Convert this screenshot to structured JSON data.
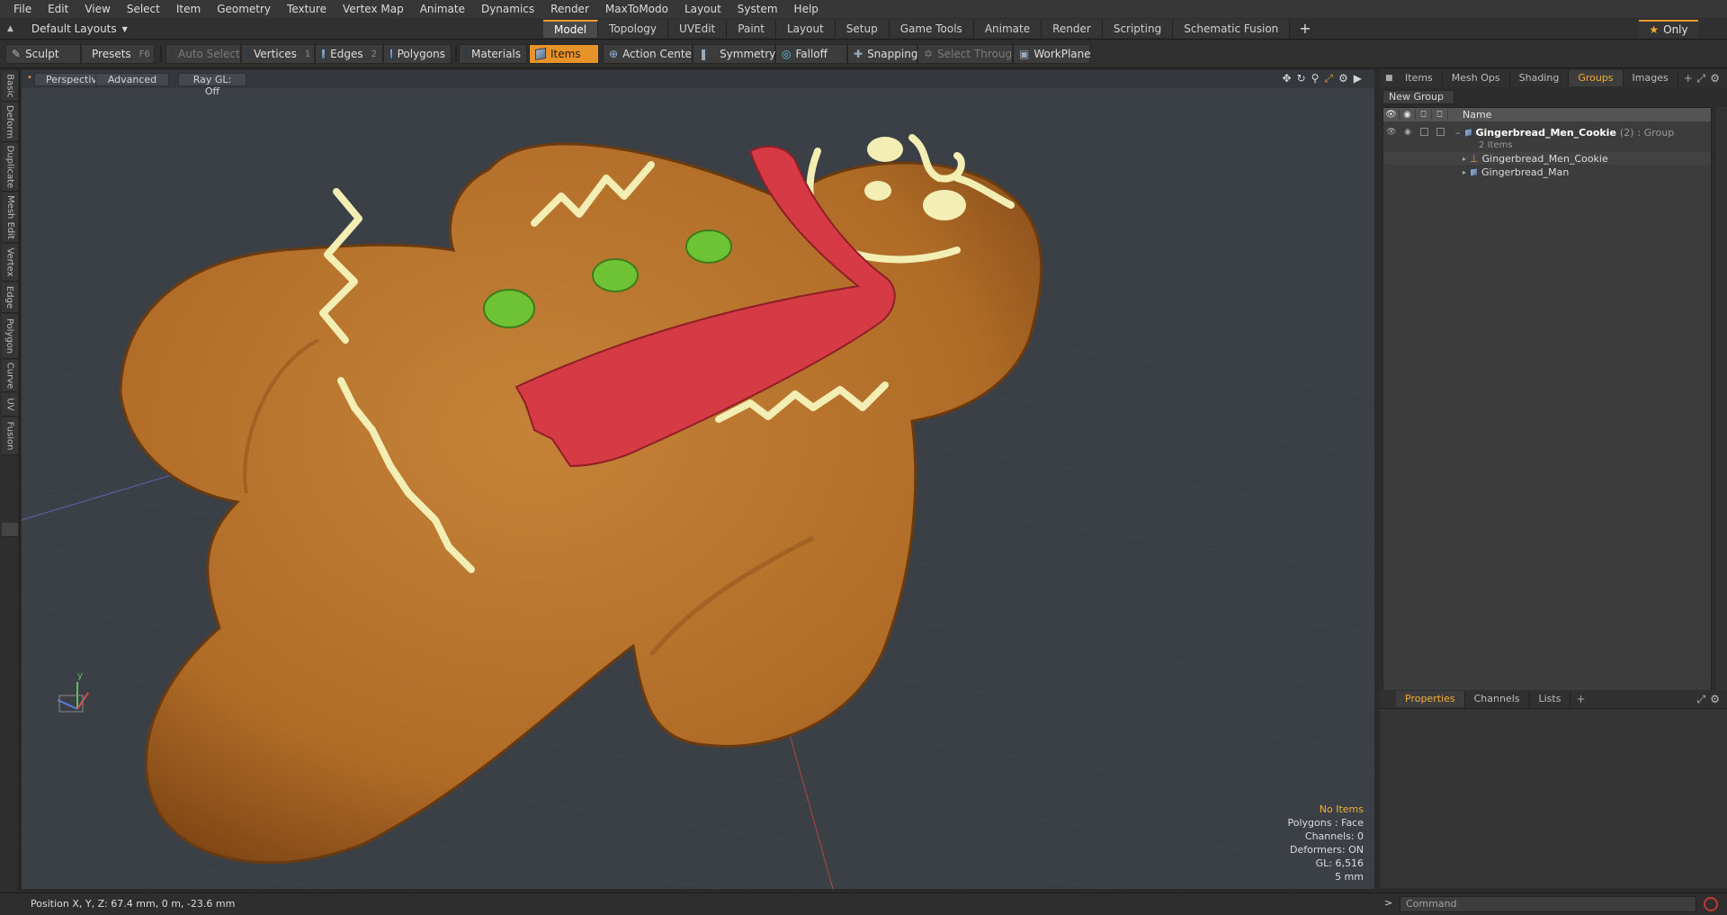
{
  "menu": [
    "File",
    "Edit",
    "View",
    "Select",
    "Item",
    "Geometry",
    "Texture",
    "Vertex Map",
    "Animate",
    "Dynamics",
    "Render",
    "MaxToModo",
    "Layout",
    "System",
    "Help"
  ],
  "layout_select": "Default Layouts",
  "tabs": [
    "Model",
    "Topology",
    "UVEdit",
    "Paint",
    "Layout",
    "Setup",
    "Game Tools",
    "Animate",
    "Render",
    "Scripting",
    "Schematic Fusion"
  ],
  "active_tab": "Model",
  "only_label": "Only",
  "toolbar": {
    "sculpt": "Sculpt",
    "presets": "Presets",
    "presets_key": "F6",
    "auto_select": "Auto Select",
    "vertices": "Vertices",
    "vertices_key": "1",
    "edges": "Edges",
    "edges_key": "2",
    "polygons": "Polygons",
    "materials": "Materials",
    "items": "Items",
    "action_center": "Action Center",
    "symmetry": "Symmetry",
    "falloff": "Falloff",
    "snapping": "Snapping",
    "select_through": "Select Through",
    "workplane": "WorkPlane"
  },
  "left_tabs": [
    "Basic",
    "Deform",
    "Duplicate",
    "Mesh Edit",
    "Vertex",
    "Edge",
    "Polygon",
    "Curve",
    "UV",
    "Fusion"
  ],
  "viewport": {
    "view": "Perspective",
    "shading": "Advanced",
    "raygl": "Ray GL: Off",
    "axis_y": "y",
    "stats": {
      "items": "No Items",
      "polygons": "Polygons : Face",
      "channels": "Channels: 0",
      "deformers": "Deformers: ON",
      "gl": "GL: 6,516",
      "grid": "5 mm"
    }
  },
  "right_panel": {
    "tabs": [
      "Items",
      "Mesh Ops",
      "Shading",
      "Groups",
      "Images"
    ],
    "active_tab": "Groups",
    "new_group": "New Group",
    "column_name": "Name",
    "group": {
      "name": "Gingerbread_Men_Cookie",
      "count": "(2)",
      "type": ": Group",
      "items_count": "2 Items",
      "children": [
        "Gingerbread_Men_Cookie",
        "Gingerbread_Man"
      ]
    },
    "bottom_tabs": [
      "Properties",
      "Channels",
      "Lists"
    ],
    "bottom_active": "Properties"
  },
  "status": {
    "position": "Position X, Y, Z:  67.4 mm, 0 m, -23.6 mm",
    "command_placeholder": "Command",
    "command_prompt": ">"
  },
  "colors": {
    "accent": "#e8932a",
    "highlight_text": "#f0b030",
    "cookie": "#b9772f",
    "icing": "#f3eeb4",
    "scarf": "#d63a44",
    "buttons": "#6ec335"
  }
}
